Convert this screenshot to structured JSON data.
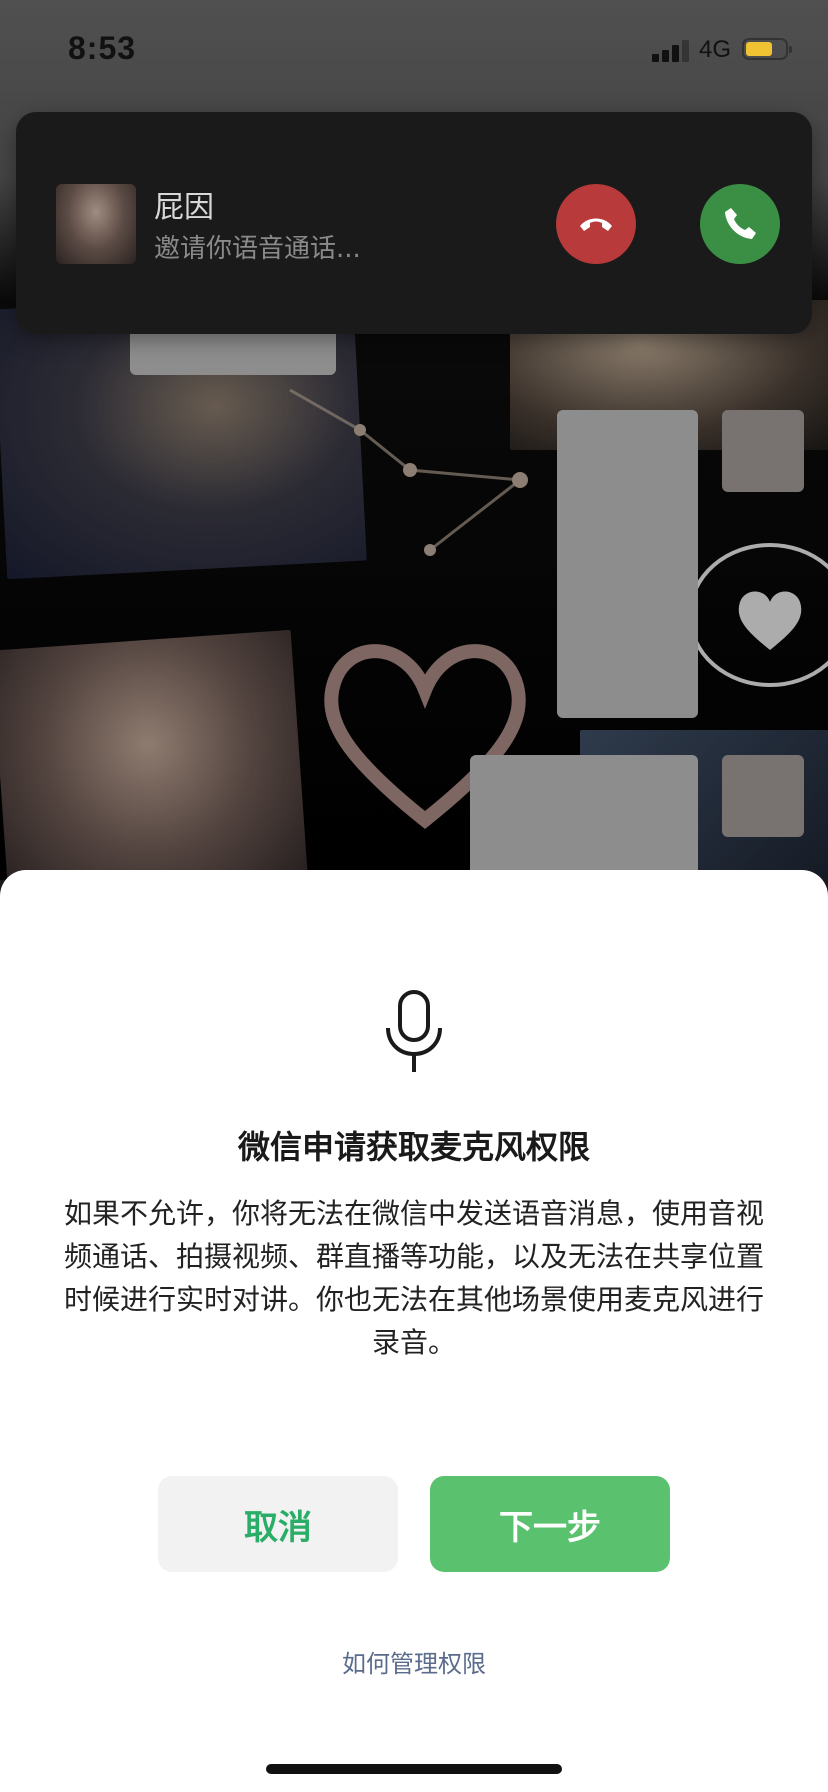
{
  "status_bar": {
    "time": "8:53",
    "network": "4G",
    "battery_color": "#f1c232"
  },
  "incoming_call": {
    "caller_name": "屁因",
    "subtitle": "邀请你语音通话...",
    "decline_color": "#b83a3a",
    "accept_color": "#3b8f45"
  },
  "permission_sheet": {
    "icon": "microphone-icon",
    "title": "微信申请获取麦克风权限",
    "description": "如果不允许，你将无法在微信中发送语音消息，使用音视频通话、拍摄视频、群直播等功能，以及无法在共享位置时候进行实时对讲。你也无法在其他场景使用麦克风进行录音。",
    "cancel_label": "取消",
    "next_label": "下一步",
    "manage_link": "如何管理权限",
    "accent_color": "#5ac26e"
  }
}
